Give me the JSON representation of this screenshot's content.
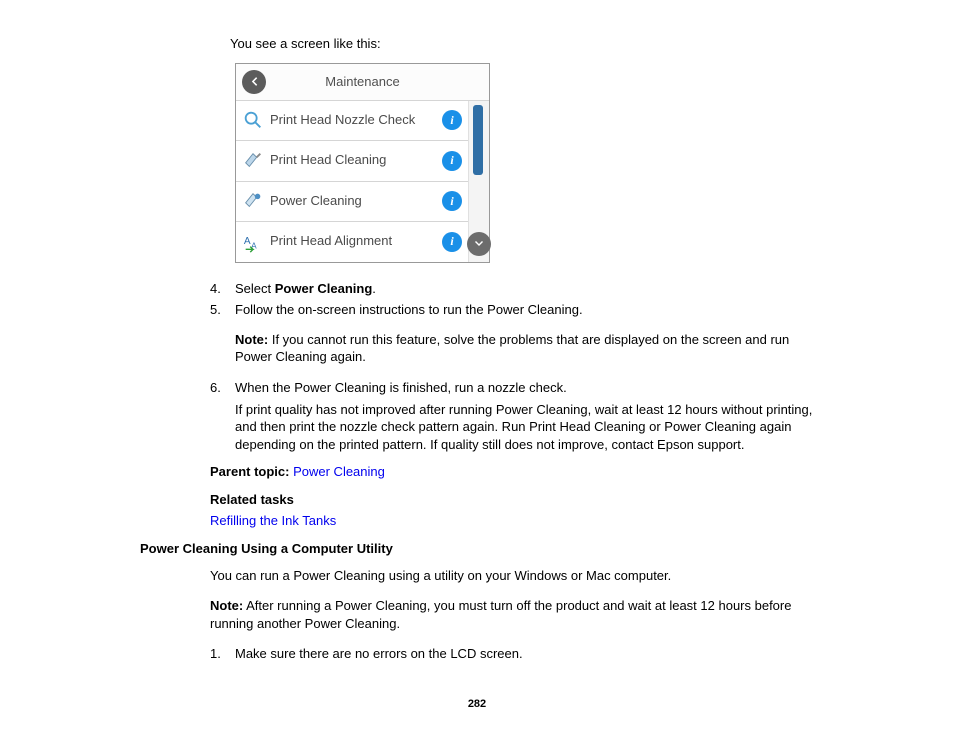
{
  "intro_line": "You see a screen like this:",
  "device": {
    "title": "Maintenance",
    "rows": [
      {
        "label": "Print Head Nozzle Check"
      },
      {
        "label": "Print Head Cleaning"
      },
      {
        "label": "Power Cleaning"
      },
      {
        "label": "Print Head Alignment"
      }
    ]
  },
  "steps_a": {
    "s4_num": "4.",
    "s4_pre": "Select ",
    "s4_bold": "Power Cleaning",
    "s4_post": ".",
    "s5_num": "5.",
    "s5_text": "Follow the on-screen instructions to run the Power Cleaning.",
    "note5_label": "Note:",
    "note5_text": " If you cannot run this feature, solve the problems that are displayed on the screen and run Power Cleaning again.",
    "s6_num": "6.",
    "s6_text": "When the Power Cleaning is finished, run a nozzle check.",
    "s6_follow": "If print quality has not improved after running Power Cleaning, wait at least 12 hours without printing, and then print the nozzle check pattern again. Run Print Head Cleaning or Power Cleaning again depending on the printed pattern. If quality still does not improve, contact Epson support."
  },
  "parent_topic_label": "Parent topic:",
  "parent_topic_link": "Power Cleaning",
  "related_tasks_label": "Related tasks",
  "related_task_link": "Refilling the Ink Tanks",
  "section2_heading": "Power Cleaning Using a Computer Utility",
  "section2_intro": "You can run a Power Cleaning using a utility on your Windows or Mac computer.",
  "section2_note_label": "Note:",
  "section2_note_text": " After running a Power Cleaning, you must turn off the product and wait at least 12 hours before running another Power Cleaning.",
  "steps_b": {
    "s1_num": "1.",
    "s1_text": "Make sure there are no errors on the LCD screen."
  },
  "page_number": "282"
}
